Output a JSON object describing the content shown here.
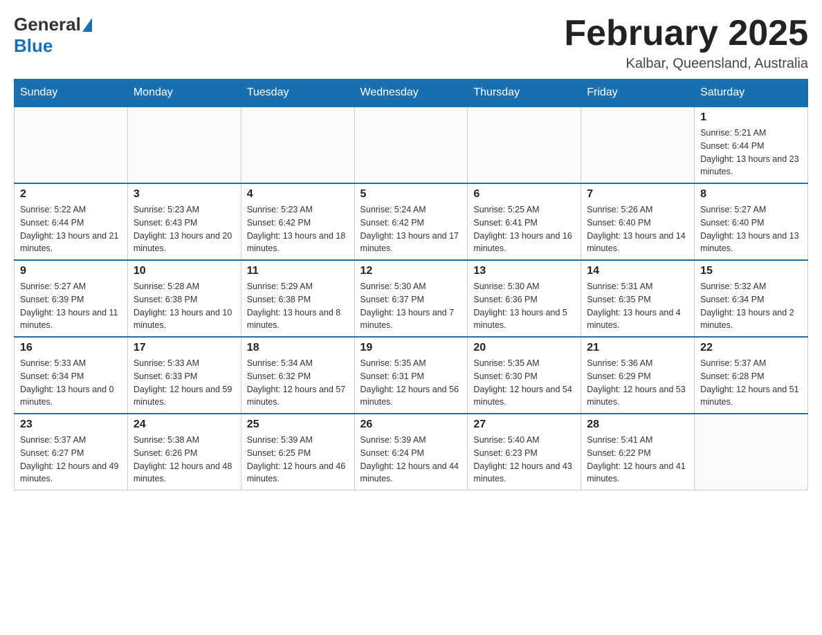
{
  "header": {
    "logo": {
      "general": "General",
      "blue": "Blue"
    },
    "title": "February 2025",
    "location": "Kalbar, Queensland, Australia"
  },
  "days_of_week": [
    "Sunday",
    "Monday",
    "Tuesday",
    "Wednesday",
    "Thursday",
    "Friday",
    "Saturday"
  ],
  "weeks": [
    [
      {
        "day": "",
        "info": ""
      },
      {
        "day": "",
        "info": ""
      },
      {
        "day": "",
        "info": ""
      },
      {
        "day": "",
        "info": ""
      },
      {
        "day": "",
        "info": ""
      },
      {
        "day": "",
        "info": ""
      },
      {
        "day": "1",
        "info": "Sunrise: 5:21 AM\nSunset: 6:44 PM\nDaylight: 13 hours and 23 minutes."
      }
    ],
    [
      {
        "day": "2",
        "info": "Sunrise: 5:22 AM\nSunset: 6:44 PM\nDaylight: 13 hours and 21 minutes."
      },
      {
        "day": "3",
        "info": "Sunrise: 5:23 AM\nSunset: 6:43 PM\nDaylight: 13 hours and 20 minutes."
      },
      {
        "day": "4",
        "info": "Sunrise: 5:23 AM\nSunset: 6:42 PM\nDaylight: 13 hours and 18 minutes."
      },
      {
        "day": "5",
        "info": "Sunrise: 5:24 AM\nSunset: 6:42 PM\nDaylight: 13 hours and 17 minutes."
      },
      {
        "day": "6",
        "info": "Sunrise: 5:25 AM\nSunset: 6:41 PM\nDaylight: 13 hours and 16 minutes."
      },
      {
        "day": "7",
        "info": "Sunrise: 5:26 AM\nSunset: 6:40 PM\nDaylight: 13 hours and 14 minutes."
      },
      {
        "day": "8",
        "info": "Sunrise: 5:27 AM\nSunset: 6:40 PM\nDaylight: 13 hours and 13 minutes."
      }
    ],
    [
      {
        "day": "9",
        "info": "Sunrise: 5:27 AM\nSunset: 6:39 PM\nDaylight: 13 hours and 11 minutes."
      },
      {
        "day": "10",
        "info": "Sunrise: 5:28 AM\nSunset: 6:38 PM\nDaylight: 13 hours and 10 minutes."
      },
      {
        "day": "11",
        "info": "Sunrise: 5:29 AM\nSunset: 6:38 PM\nDaylight: 13 hours and 8 minutes."
      },
      {
        "day": "12",
        "info": "Sunrise: 5:30 AM\nSunset: 6:37 PM\nDaylight: 13 hours and 7 minutes."
      },
      {
        "day": "13",
        "info": "Sunrise: 5:30 AM\nSunset: 6:36 PM\nDaylight: 13 hours and 5 minutes."
      },
      {
        "day": "14",
        "info": "Sunrise: 5:31 AM\nSunset: 6:35 PM\nDaylight: 13 hours and 4 minutes."
      },
      {
        "day": "15",
        "info": "Sunrise: 5:32 AM\nSunset: 6:34 PM\nDaylight: 13 hours and 2 minutes."
      }
    ],
    [
      {
        "day": "16",
        "info": "Sunrise: 5:33 AM\nSunset: 6:34 PM\nDaylight: 13 hours and 0 minutes."
      },
      {
        "day": "17",
        "info": "Sunrise: 5:33 AM\nSunset: 6:33 PM\nDaylight: 12 hours and 59 minutes."
      },
      {
        "day": "18",
        "info": "Sunrise: 5:34 AM\nSunset: 6:32 PM\nDaylight: 12 hours and 57 minutes."
      },
      {
        "day": "19",
        "info": "Sunrise: 5:35 AM\nSunset: 6:31 PM\nDaylight: 12 hours and 56 minutes."
      },
      {
        "day": "20",
        "info": "Sunrise: 5:35 AM\nSunset: 6:30 PM\nDaylight: 12 hours and 54 minutes."
      },
      {
        "day": "21",
        "info": "Sunrise: 5:36 AM\nSunset: 6:29 PM\nDaylight: 12 hours and 53 minutes."
      },
      {
        "day": "22",
        "info": "Sunrise: 5:37 AM\nSunset: 6:28 PM\nDaylight: 12 hours and 51 minutes."
      }
    ],
    [
      {
        "day": "23",
        "info": "Sunrise: 5:37 AM\nSunset: 6:27 PM\nDaylight: 12 hours and 49 minutes."
      },
      {
        "day": "24",
        "info": "Sunrise: 5:38 AM\nSunset: 6:26 PM\nDaylight: 12 hours and 48 minutes."
      },
      {
        "day": "25",
        "info": "Sunrise: 5:39 AM\nSunset: 6:25 PM\nDaylight: 12 hours and 46 minutes."
      },
      {
        "day": "26",
        "info": "Sunrise: 5:39 AM\nSunset: 6:24 PM\nDaylight: 12 hours and 44 minutes."
      },
      {
        "day": "27",
        "info": "Sunrise: 5:40 AM\nSunset: 6:23 PM\nDaylight: 12 hours and 43 minutes."
      },
      {
        "day": "28",
        "info": "Sunrise: 5:41 AM\nSunset: 6:22 PM\nDaylight: 12 hours and 41 minutes."
      },
      {
        "day": "",
        "info": ""
      }
    ]
  ]
}
